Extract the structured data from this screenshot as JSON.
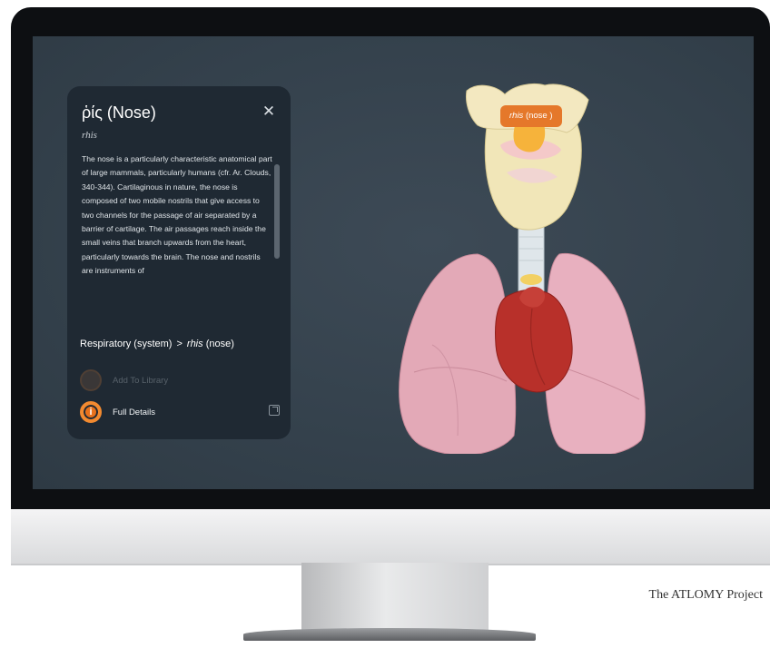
{
  "panel": {
    "title": "ῥίς (Nose)",
    "subtitle": "rhis",
    "description": "The nose is a particularly characteristic anatomical part of large mammals, particularly humans (cfr. Ar. Clouds, 340-344). Cartilaginous in nature, the nose is composed of two mobile nostrils that give access to two channels for the passage of air separated by a barrier of cartilage. The air passages reach inside the small veins that branch upwards from the heart, particularly towards the brain. The nose and nostrils are instruments of",
    "breadcrumb": {
      "parent": "Respiratory (system)",
      "separator": ">",
      "current_term": "rhis",
      "current_suffix": " (nose)"
    },
    "actions": {
      "add_to_library": "Add To Library",
      "full_details": "Full Details",
      "info_icon_glyph": "i"
    },
    "close_glyph": "✕"
  },
  "model": {
    "tag_term": "rhis",
    "tag_suffix": " (nose )",
    "tag_color": "#e5782a"
  },
  "caption": "The ATLOMY Project",
  "colors": {
    "screen_bg": "#34414c",
    "panel_bg": "#1f2933",
    "accent": "#e8711c"
  }
}
